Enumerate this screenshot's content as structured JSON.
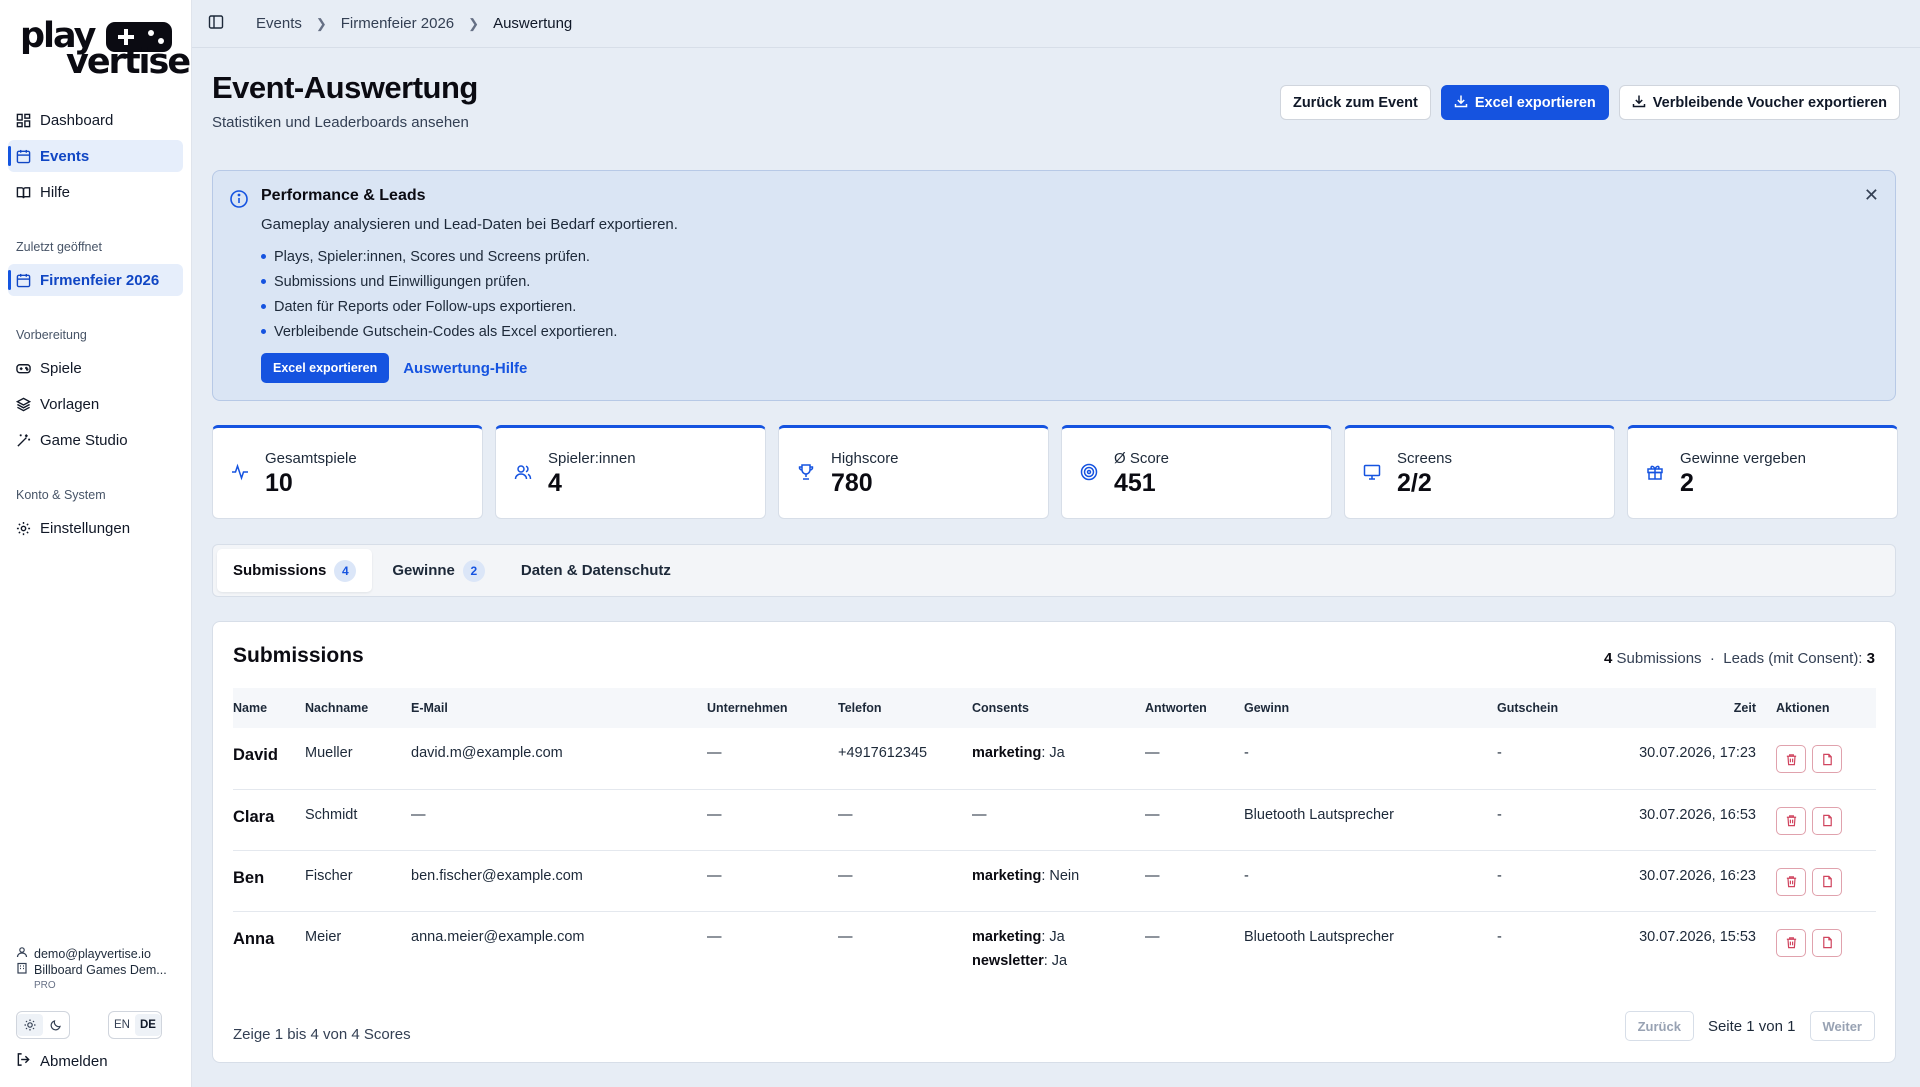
{
  "brand": {
    "line1": "play",
    "line2": "vertise"
  },
  "sidebar": {
    "main_items": [
      {
        "label": "Dashboard",
        "icon": "grid-icon"
      },
      {
        "label": "Events",
        "icon": "calendar-icon",
        "active": true
      },
      {
        "label": "Hilfe",
        "icon": "book-icon"
      }
    ],
    "recent_label": "Zuletzt geöffnet",
    "recent_item": {
      "label": "Firmenfeier 2026",
      "icon": "calendar-icon"
    },
    "prep_label": "Vorbereitung",
    "prep_items": [
      {
        "label": "Spiele",
        "icon": "gamepad-icon"
      },
      {
        "label": "Vorlagen",
        "icon": "layers-icon"
      },
      {
        "label": "Game Studio",
        "icon": "wand-icon"
      }
    ],
    "account_label": "Konto & System",
    "account_items": [
      {
        "label": "Einstellungen",
        "icon": "gear-icon"
      }
    ],
    "user": {
      "email": "demo@playvertise.io",
      "org": "Billboard Games Dem...",
      "plan": "PRO"
    },
    "lang": {
      "en": "EN",
      "de": "DE",
      "active": "DE"
    },
    "logout": "Abmelden"
  },
  "breadcrumb": [
    "Events",
    "Firmenfeier 2026",
    "Auswertung"
  ],
  "header": {
    "title": "Event-Auswertung",
    "subtitle": "Statistiken und Leaderboards ansehen",
    "back_btn": "Zurück zum Event",
    "export_btn": "Excel exportieren",
    "voucher_btn": "Verbleibende Voucher exportieren"
  },
  "info": {
    "title": "Performance & Leads",
    "desc": "Gameplay analysieren und Lead-Daten bei Bedarf exportieren.",
    "bullets": [
      "Plays, Spieler:innen, Scores und Screens prüfen.",
      "Submissions und Einwilligungen prüfen.",
      "Daten für Reports oder Follow-ups exportieren.",
      "Verbleibende Gutschein-Codes als Excel exportieren."
    ],
    "export_btn": "Excel exportieren",
    "help_link": "Auswertung-Hilfe"
  },
  "stats": [
    {
      "label": "Gesamtspiele",
      "value": "10",
      "icon": "activity-icon"
    },
    {
      "label": "Spieler:innen",
      "value": "4",
      "icon": "users-icon"
    },
    {
      "label": "Highscore",
      "value": "780",
      "icon": "trophy-icon"
    },
    {
      "label": "Ø Score",
      "value": "451",
      "icon": "target-icon"
    },
    {
      "label": "Screens",
      "value": "2/2",
      "icon": "monitor-icon"
    },
    {
      "label": "Gewinne vergeben",
      "value": "2",
      "icon": "gift-icon"
    }
  ],
  "tabs": [
    {
      "label": "Submissions",
      "count": "4",
      "active": true
    },
    {
      "label": "Gewinne",
      "count": "2"
    },
    {
      "label": "Daten & Datenschutz"
    }
  ],
  "submissions": {
    "title": "Submissions",
    "summary_count": "4",
    "summary_label": "Submissions",
    "summary_sep": "·",
    "leads_label": "Leads (mit Consent):",
    "leads_count": "3",
    "columns": [
      "Name",
      "Nachname",
      "E-Mail",
      "Unternehmen",
      "Telefon",
      "Consents",
      "Antworten",
      "Gewinn",
      "Gutschein",
      "Zeit",
      "Aktionen"
    ],
    "rows": [
      {
        "name": "David",
        "last": "Mueller",
        "email": "david.m@example.com",
        "company": "—",
        "phone": "+4917612345",
        "consents": [
          {
            "key": "marketing",
            "val": "Ja"
          }
        ],
        "answers": "—",
        "prize": "-",
        "voucher": "-",
        "time": "30.07.2026, 17:23"
      },
      {
        "name": "Clara",
        "last": "Schmidt",
        "email": "—",
        "company": "—",
        "phone": "—",
        "consents_text": "—",
        "consents": [],
        "answers": "—",
        "prize": "Bluetooth Lautsprecher",
        "voucher": "-",
        "time": "30.07.2026, 16:53"
      },
      {
        "name": "Ben",
        "last": "Fischer",
        "email": "ben.fischer@example.com",
        "company": "—",
        "phone": "—",
        "consents": [
          {
            "key": "marketing",
            "val": "Nein"
          }
        ],
        "answers": "—",
        "prize": "-",
        "voucher": "-",
        "time": "30.07.2026, 16:23"
      },
      {
        "name": "Anna",
        "last": "Meier",
        "email": "anna.meier@example.com",
        "company": "—",
        "phone": "—",
        "consents": [
          {
            "key": "marketing",
            "val": "Ja"
          },
          {
            "key": "newsletter",
            "val": "Ja"
          }
        ],
        "answers": "—",
        "prize": "Bluetooth Lautsprecher",
        "voucher": "-",
        "time": "30.07.2026, 15:53"
      }
    ],
    "pager_info": "Zeige 1 bis 4 von 4 Scores",
    "prev": "Zurück",
    "page": "Seite 1 von 1",
    "next": "Weiter"
  },
  "colors": {
    "accent": "#1553e0",
    "danger": "#d0445e",
    "page_bg": "#e7edf5"
  }
}
